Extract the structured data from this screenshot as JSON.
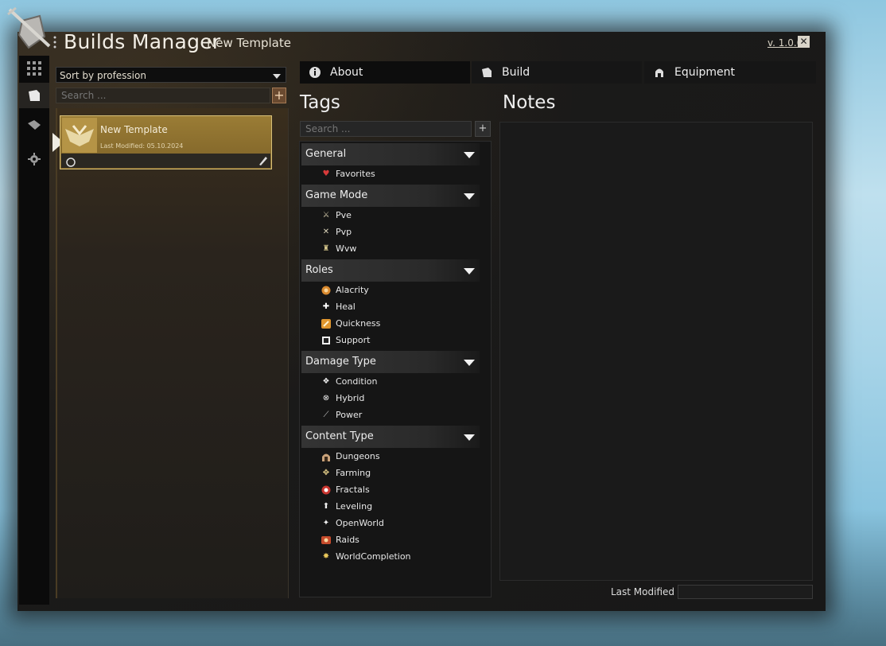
{
  "app": {
    "title": "Builds Manager",
    "template_name": "New Template",
    "version": "v. 1.0.0"
  },
  "left": {
    "sort_value": "Sort by profession",
    "search_placeholder": "Search ...",
    "template": {
      "name": "New Template",
      "last_modified": "Last Modified: 05.10.2024"
    }
  },
  "tabs": [
    {
      "label": "About",
      "icon": "info-icon"
    },
    {
      "label": "Build",
      "icon": "build-icon"
    },
    {
      "label": "Equipment",
      "icon": "helmet-icon"
    }
  ],
  "tags": {
    "heading": "Tags",
    "search_placeholder": "Search ...",
    "add_label": "+",
    "categories": [
      {
        "name": "General",
        "items": [
          "Favorites"
        ]
      },
      {
        "name": "Game Mode",
        "items": [
          "Pve",
          "Pvp",
          "Wvw"
        ]
      },
      {
        "name": "Roles",
        "items": [
          "Alacrity",
          "Heal",
          "Quickness",
          "Support"
        ]
      },
      {
        "name": "Damage Type",
        "items": [
          "Condition",
          "Hybrid",
          "Power"
        ]
      },
      {
        "name": "Content Type",
        "items": [
          "Dungeons",
          "Farming",
          "Fractals",
          "Leveling",
          "OpenWorld",
          "Raids",
          "WorldCompletion"
        ]
      }
    ]
  },
  "notes": {
    "heading": "Notes",
    "value": "",
    "last_modified_label": "Last Modified",
    "last_modified_value": ""
  },
  "colors": {
    "template_gold": "#9a7c35",
    "frame_dark": "#181818",
    "favorites_heart": "#d83a3a"
  }
}
